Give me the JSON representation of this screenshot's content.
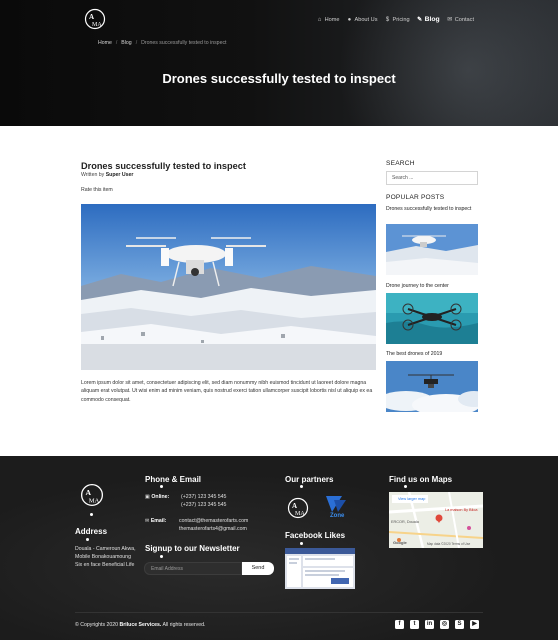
{
  "nav": {
    "items": [
      {
        "label": "Home",
        "icon": "home-icon",
        "glyph": "⌂"
      },
      {
        "label": "About Us",
        "icon": "user-icon",
        "glyph": "●"
      },
      {
        "label": "Pricing",
        "icon": "dollar-icon",
        "glyph": "$"
      },
      {
        "label": "Blog",
        "icon": "blog-icon",
        "glyph": "✎",
        "active": true
      },
      {
        "label": "Contact",
        "icon": "envelope-icon",
        "glyph": "✉"
      }
    ]
  },
  "breadcrumb": {
    "home": "Home",
    "sep": "/",
    "blog": "Blog",
    "current": "Drones successfully tested to inspect"
  },
  "hero": {
    "title": "Drones successfully tested to inspect"
  },
  "article": {
    "title": "Drones successfully tested to inspect",
    "written_by_prefix": "Written by",
    "author": "Super User",
    "rate": "Rate this item",
    "body": "Lorem ipsum dolor sit amet, consectetuer adipiscing elit, sed diam nonummy nibh euismod tincidunt ut laoreet dolore magna aliquam erat volutpat. Ut wisi enim ad minim veniam, quis nostrud exerci tation ullamcorper suscipit lobortis nisl ut aliquip ex ea commodo consequat."
  },
  "sidebar": {
    "search_heading": "SEARCH",
    "search_placeholder": "Search ...",
    "popular_heading": "POPULAR POSTS",
    "posts": [
      {
        "title": "Drones successfully tested to inspect"
      },
      {
        "title": "Drone journey to the center"
      },
      {
        "title": "The best drones of 2019"
      }
    ]
  },
  "footer": {
    "address_heading": "Address",
    "address_text": "Douala - Cameroun Akwa, Mobile Bonakouamoung Six en face Beneficial Life",
    "phone_heading": "Phone & Email",
    "online_label": "Online:",
    "phone_1": "(+237) 123 345 545",
    "phone_2": "(+237) 123 345 545",
    "email_label": "Email:",
    "email_1": "contact@themasterofarts.com",
    "email_2": "themasterofarts4@gmail.com",
    "newsletter_heading": "Signup to our Newsletter",
    "newsletter_placeholder": "Email Address",
    "newsletter_button": "Send",
    "partners_heading": "Our partners",
    "partner_2": "Zone",
    "facebook_heading": "Facebook Likes",
    "maps_heading": "Find us on Maps",
    "map_link": "View larger map",
    "map_place": "La maison By Biloa",
    "map_area": "ERCOR, Douala",
    "map_google": "Google",
    "map_attribution": "Map data ©2020  Terms of Use",
    "copyright_prefix": "© Copyrights 2020",
    "copyright_company": "Briluce Services.",
    "copyright_suffix": "All rights reserved.",
    "social": [
      {
        "icon": "facebook-icon",
        "glyph": "f"
      },
      {
        "icon": "twitter-icon",
        "glyph": "t"
      },
      {
        "icon": "linkedin-icon",
        "glyph": "in"
      },
      {
        "icon": "instagram-icon",
        "glyph": "◎"
      },
      {
        "icon": "skype-icon",
        "glyph": "S"
      },
      {
        "icon": "youtube-icon",
        "glyph": "▶"
      }
    ]
  },
  "colors": {
    "header_bg": "#0f0f0f",
    "footer_bg": "#1c1c1c",
    "text": "#222222"
  }
}
